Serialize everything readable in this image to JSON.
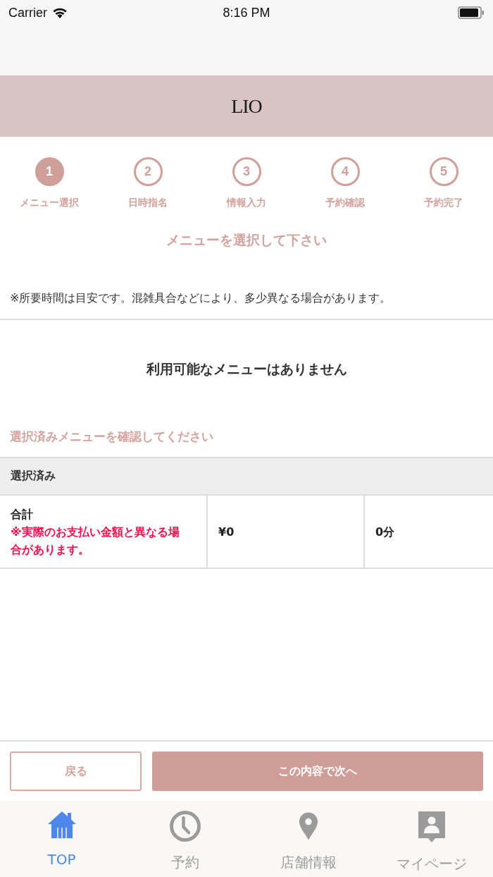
{
  "status_bar": {
    "carrier": "Carrier",
    "time": "8:16 PM"
  },
  "header": {
    "logo": "LIO"
  },
  "steps": [
    {
      "number": "1",
      "label": "メニュー選択",
      "selected": true
    },
    {
      "number": "2",
      "label": "日時指名",
      "selected": false
    },
    {
      "number": "3",
      "label": "情報入力",
      "selected": false
    },
    {
      "number": "4",
      "label": "予約確認",
      "selected": false
    },
    {
      "number": "5",
      "label": "予約完了",
      "selected": false
    }
  ],
  "title": "メニューを選択して下さい",
  "note": "※所要時間は目安です。混雑具合などにより、多少異なる場合があります。",
  "empty_message": "利用可能なメニューはありません",
  "selected_prompt": "選択済みメニューを確認してください",
  "selected_section": {
    "heading": "選択済み",
    "total": {
      "label": "合計",
      "warning": "※実際のお支払い金額と異なる場合があります。",
      "price": "¥0",
      "duration": "0分"
    }
  },
  "buttons": [
    {
      "label": "戻る",
      "kind": "secondary"
    },
    {
      "label": "この内容で次へ",
      "kind": "primary"
    }
  ],
  "tab_bar": [
    {
      "label": "TOP",
      "selected": true
    },
    {
      "label": "予約",
      "selected": false
    },
    {
      "label": "店舗情報",
      "selected": false
    },
    {
      "label": "マイページ",
      "selected": false
    }
  ]
}
